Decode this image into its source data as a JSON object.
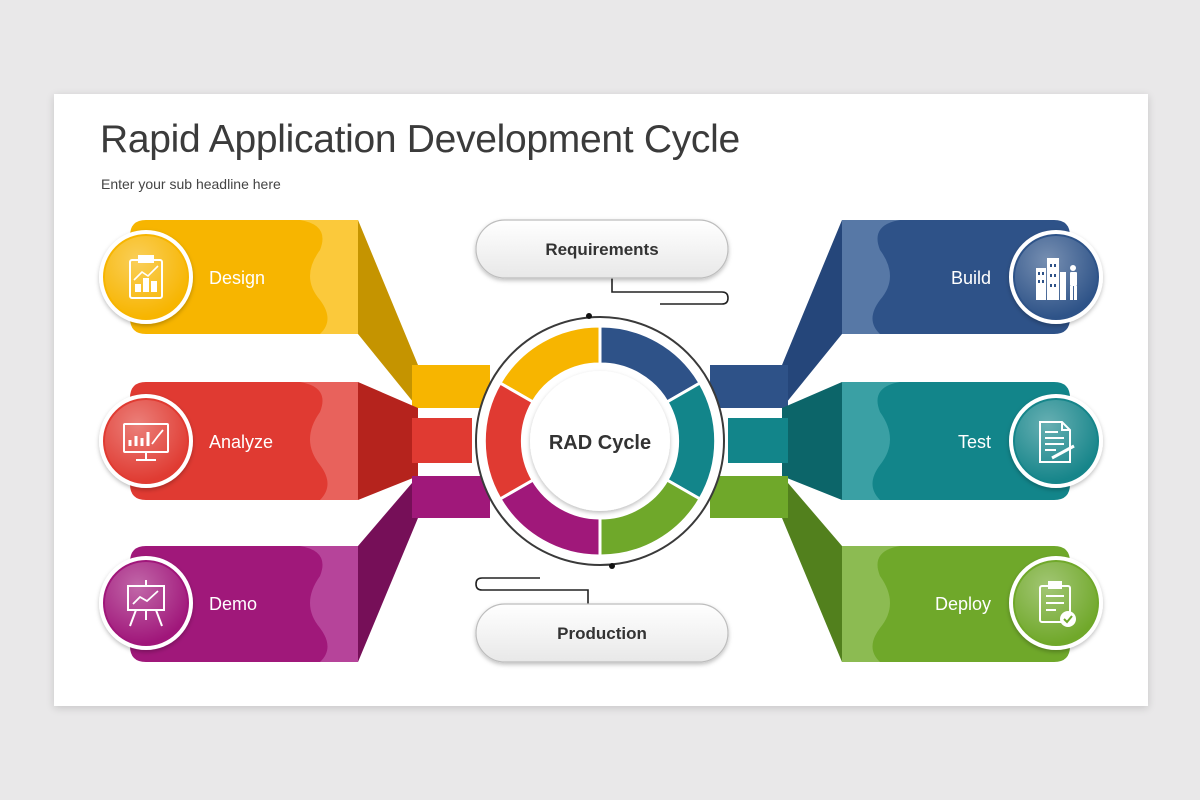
{
  "title": "Rapid Application Development Cycle",
  "subtitle": "Enter your sub headline here",
  "center_label": "RAD Cycle",
  "top_box": "Requirements",
  "bottom_box": "Production",
  "left_items": [
    {
      "label": "Design",
      "icon": "clipboard-chart-icon",
      "color": "#f7b500"
    },
    {
      "label": "Analyze",
      "icon": "monitor-chart-icon",
      "color": "#e03a32"
    },
    {
      "label": "Demo",
      "icon": "presentation-board-icon",
      "color": "#a0187a"
    }
  ],
  "right_items": [
    {
      "label": "Build",
      "icon": "buildings-person-icon",
      "color": "#2e5288"
    },
    {
      "label": "Test",
      "icon": "document-pen-icon",
      "color": "#12858a"
    },
    {
      "label": "Deploy",
      "icon": "checklist-icon",
      "color": "#6fa82a"
    }
  ]
}
